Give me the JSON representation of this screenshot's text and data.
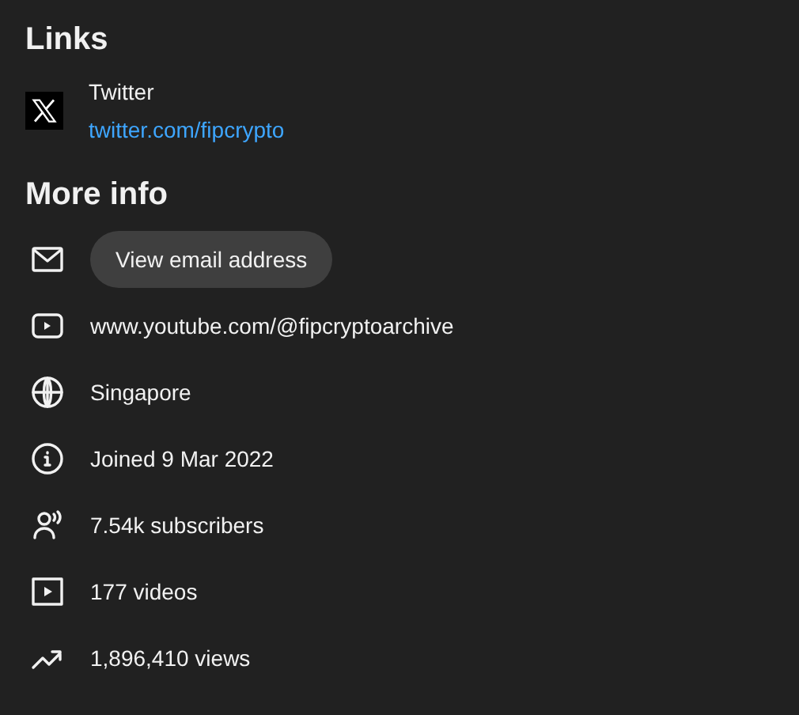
{
  "links": {
    "title": "Links",
    "items": [
      {
        "name": "Twitter",
        "url": "twitter.com/fipcrypto"
      }
    ]
  },
  "more_info": {
    "title": "More info",
    "items": [
      {
        "kind": "email",
        "label": "View email address"
      },
      {
        "kind": "url",
        "label": "www.youtube.com/@fipcryptoarchive"
      },
      {
        "kind": "location",
        "label": "Singapore"
      },
      {
        "kind": "joined",
        "label": "Joined 9 Mar 2022"
      },
      {
        "kind": "subscribers",
        "label": "7.54k subscribers"
      },
      {
        "kind": "videos",
        "label": "177 videos"
      },
      {
        "kind": "views",
        "label": "1,896,410 views"
      }
    ]
  }
}
